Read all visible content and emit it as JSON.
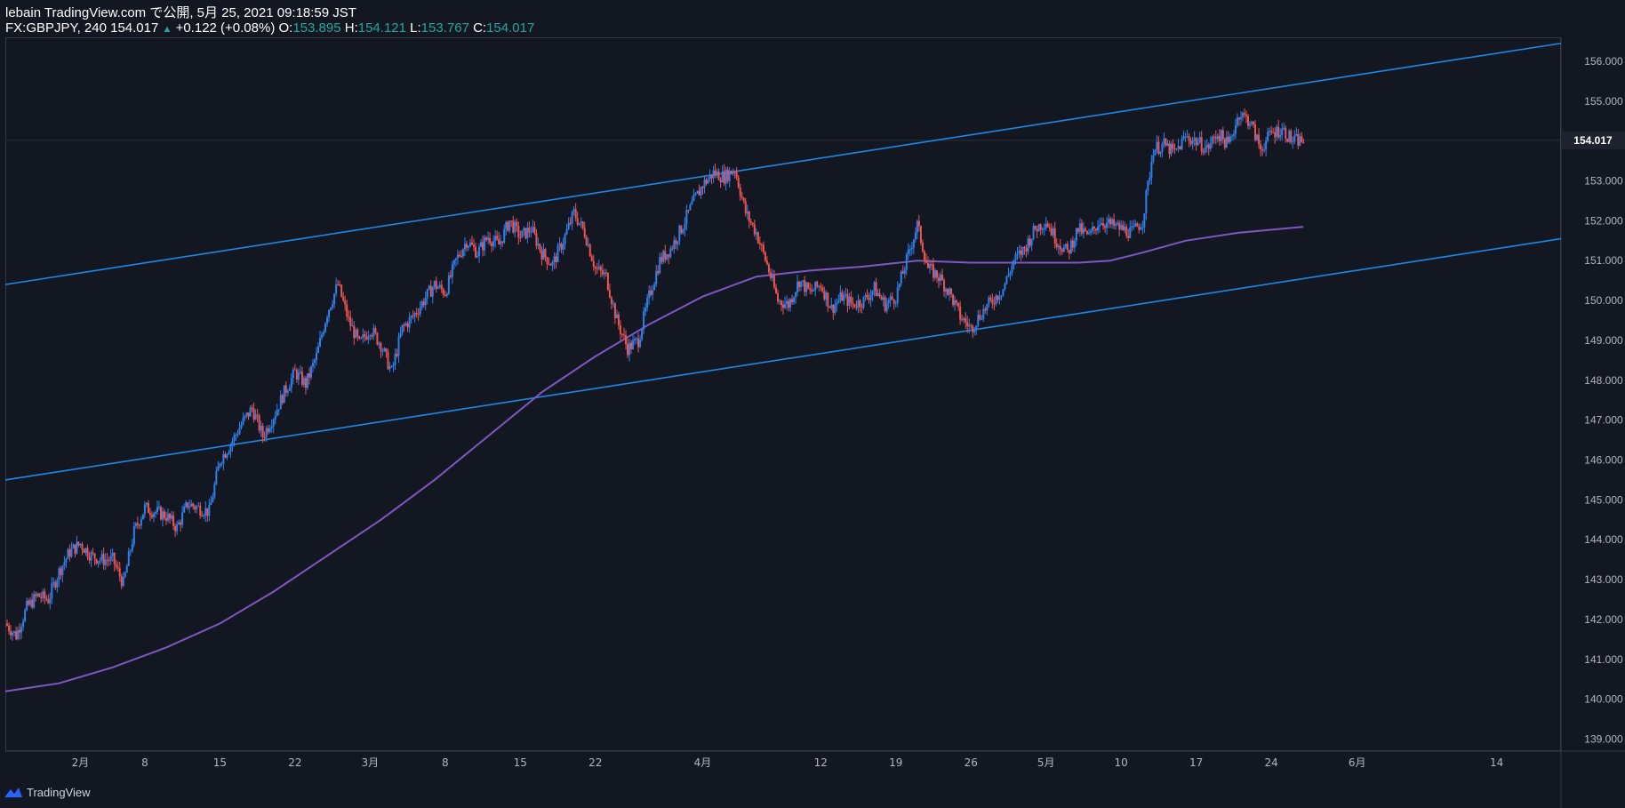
{
  "header": {
    "line1": "lebain TradingView.com で公開, 5月 25, 2021 09:18:59 JST",
    "symbol_tf_last": "FX:GBPJPY, 240 154.017",
    "change_arrow": "▲",
    "change": "+0.122 (+0.08%)",
    "o_label": "O:",
    "o_value": "153.895",
    "h_label": "H:",
    "h_value": "154.121",
    "l_label": "L:",
    "l_value": "153.767",
    "c_label": "C:",
    "c_value": "154.017"
  },
  "footer": {
    "brand": "TradingView",
    "logo_icon": "tradingview-logo-icon"
  },
  "colors": {
    "background": "#131722",
    "up": "#2f80ed",
    "down": "#ef5350",
    "channel": "#1e88e5",
    "ma": "#7e57c2",
    "price_tag_bg": "#1e222d",
    "axis_text": "#b2b5be"
  },
  "chart_data": {
    "type": "candlestick",
    "symbol": "FX:GBPJPY",
    "timeframe": "240",
    "last_price_label": "154.017",
    "y_ticks": [
      "156.000",
      "155.000",
      "154.000",
      "153.000",
      "152.000",
      "151.000",
      "150.000",
      "149.000",
      "148.000",
      "147.000",
      "146.000",
      "145.000",
      "144.000",
      "143.000",
      "142.000",
      "141.000",
      "140.000",
      "139.000"
    ],
    "ylim": [
      138.7,
      156.6
    ],
    "x_ticks": [
      {
        "label": "2月",
        "day": 7
      },
      {
        "label": "8",
        "day": 13
      },
      {
        "label": "15",
        "day": 20
      },
      {
        "label": "22",
        "day": 27
      },
      {
        "label": "3月",
        "day": 34
      },
      {
        "label": "8",
        "day": 41
      },
      {
        "label": "15",
        "day": 48
      },
      {
        "label": "22",
        "day": 55
      },
      {
        "label": "4月",
        "day": 65
      },
      {
        "label": "12",
        "day": 76
      },
      {
        "label": "19",
        "day": 83
      },
      {
        "label": "26",
        "day": 90
      },
      {
        "label": "5月",
        "day": 97
      },
      {
        "label": "10",
        "day": 104
      },
      {
        "label": "17",
        "day": 111
      },
      {
        "label": "24",
        "day": 118
      },
      {
        "label": "6月",
        "day": 126
      },
      {
        "label": "14",
        "day": 139
      }
    ],
    "xlim": [
      0,
      145
    ],
    "close_path": [
      [
        0,
        141.9
      ],
      [
        1,
        141.6
      ],
      [
        2,
        142.3
      ],
      [
        3,
        142.6
      ],
      [
        4,
        142.5
      ],
      [
        5,
        143.2
      ],
      [
        6,
        143.7
      ],
      [
        7,
        143.9
      ],
      [
        8,
        143.6
      ],
      [
        9,
        143.5
      ],
      [
        10,
        143.5
      ],
      [
        11,
        142.9
      ],
      [
        12,
        144.2
      ],
      [
        13,
        144.8
      ],
      [
        14,
        144.7
      ],
      [
        15,
        144.6
      ],
      [
        16,
        144.3
      ],
      [
        17,
        144.9
      ],
      [
        18,
        144.8
      ],
      [
        19,
        144.7
      ],
      [
        20,
        146.0
      ],
      [
        21,
        146.4
      ],
      [
        22,
        146.9
      ],
      [
        23,
        147.3
      ],
      [
        24,
        146.6
      ],
      [
        25,
        147.1
      ],
      [
        26,
        147.7
      ],
      [
        27,
        148.2
      ],
      [
        28,
        147.9
      ],
      [
        29,
        148.6
      ],
      [
        30,
        149.7
      ],
      [
        31,
        150.4
      ],
      [
        32,
        149.5
      ],
      [
        33,
        148.9
      ],
      [
        34,
        149.3
      ],
      [
        35,
        148.9
      ],
      [
        36,
        148.2
      ],
      [
        37,
        149.3
      ],
      [
        38,
        149.6
      ],
      [
        39,
        150.0
      ],
      [
        40,
        150.4
      ],
      [
        41,
        150.2
      ],
      [
        42,
        151.0
      ],
      [
        43,
        151.5
      ],
      [
        44,
        151.2
      ],
      [
        45,
        151.6
      ],
      [
        46,
        151.4
      ],
      [
        47,
        152.0
      ],
      [
        48,
        151.6
      ],
      [
        49,
        151.8
      ],
      [
        50,
        151.2
      ],
      [
        51,
        150.9
      ],
      [
        52,
        151.5
      ],
      [
        53,
        152.2
      ],
      [
        54,
        151.7
      ],
      [
        55,
        150.8
      ],
      [
        56,
        150.6
      ],
      [
        57,
        149.5
      ],
      [
        58,
        148.8
      ],
      [
        59,
        149.0
      ],
      [
        60,
        150.1
      ],
      [
        61,
        151.0
      ],
      [
        62,
        151.3
      ],
      [
        63,
        151.8
      ],
      [
        64,
        152.4
      ],
      [
        65,
        152.9
      ],
      [
        66,
        153.2
      ],
      [
        67,
        153.1
      ],
      [
        68,
        153.3
      ],
      [
        69,
        152.2
      ],
      [
        70,
        151.7
      ],
      [
        71,
        150.9
      ],
      [
        72,
        150.0
      ],
      [
        73,
        149.9
      ],
      [
        74,
        150.5
      ],
      [
        75,
        150.2
      ],
      [
        76,
        150.4
      ],
      [
        77,
        149.8
      ],
      [
        78,
        150.1
      ],
      [
        79,
        149.9
      ],
      [
        80,
        150.0
      ],
      [
        81,
        150.3
      ],
      [
        82,
        149.9
      ],
      [
        83,
        150.1
      ],
      [
        84,
        151.0
      ],
      [
        85,
        151.9
      ],
      [
        86,
        150.8
      ],
      [
        87,
        150.6
      ],
      [
        88,
        150.2
      ],
      [
        89,
        149.6
      ],
      [
        90,
        149.3
      ],
      [
        91,
        149.7
      ],
      [
        92,
        150.0
      ],
      [
        93,
        150.3
      ],
      [
        94,
        151.0
      ],
      [
        95,
        151.3
      ],
      [
        96,
        151.8
      ],
      [
        97,
        152.0
      ],
      [
        98,
        151.5
      ],
      [
        99,
        151.2
      ],
      [
        100,
        151.8
      ],
      [
        101,
        151.6
      ],
      [
        102,
        152.0
      ],
      [
        103,
        151.9
      ],
      [
        104,
        151.8
      ],
      [
        105,
        151.7
      ],
      [
        106,
        152.0
      ],
      [
        107,
        153.8
      ],
      [
        108,
        153.9
      ],
      [
        109,
        153.7
      ],
      [
        110,
        154.1
      ],
      [
        111,
        154.0
      ],
      [
        112,
        153.8
      ],
      [
        113,
        154.2
      ],
      [
        114,
        153.9
      ],
      [
        115,
        154.7
      ],
      [
        116,
        154.5
      ],
      [
        117,
        153.8
      ],
      [
        118,
        154.2
      ],
      [
        119,
        154.3
      ],
      [
        120,
        154.0
      ],
      [
        121,
        154.017
      ]
    ],
    "moving_average": [
      [
        0,
        140.2
      ],
      [
        5,
        140.4
      ],
      [
        10,
        140.8
      ],
      [
        15,
        141.3
      ],
      [
        20,
        141.9
      ],
      [
        25,
        142.7
      ],
      [
        30,
        143.6
      ],
      [
        35,
        144.5
      ],
      [
        40,
        145.5
      ],
      [
        45,
        146.6
      ],
      [
        50,
        147.7
      ],
      [
        55,
        148.6
      ],
      [
        60,
        149.4
      ],
      [
        65,
        150.1
      ],
      [
        70,
        150.6
      ],
      [
        75,
        150.75
      ],
      [
        80,
        150.85
      ],
      [
        85,
        151.0
      ],
      [
        90,
        150.95
      ],
      [
        95,
        150.95
      ],
      [
        100,
        150.95
      ],
      [
        103,
        151.0
      ],
      [
        106,
        151.2
      ],
      [
        110,
        151.5
      ],
      [
        115,
        151.7
      ],
      [
        121,
        151.85
      ]
    ],
    "channel_upper": [
      [
        0,
        150.4
      ],
      [
        145,
        156.45
      ]
    ],
    "channel_lower": [
      [
        0,
        145.5
      ],
      [
        145,
        151.55
      ]
    ]
  }
}
